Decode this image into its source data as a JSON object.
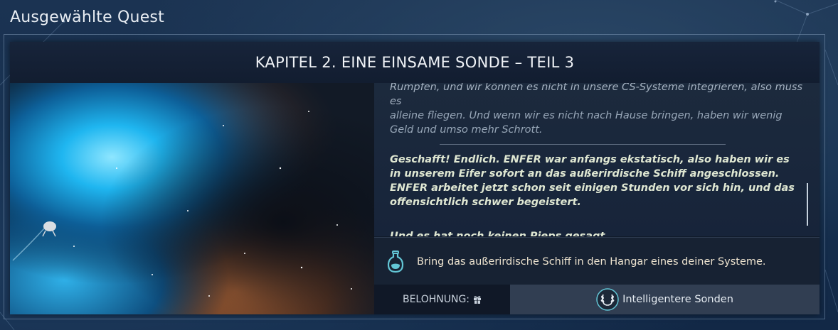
{
  "header": {
    "title": "Ausgewählte Quest"
  },
  "quest": {
    "chapter_title": "KAPITEL 2. EINE EINSAME SONDE – TEIL 3",
    "story": {
      "partial_line": "Rumpfen, und wir können es nicht in unsere CS-Systeme integrieren, also muss es",
      "paragraph_1": "alleine fliegen. Und wenn wir es nicht nach Hause bringen, haben wir wenig Geld und umso mehr Schrott.",
      "paragraph_2": "Geschafft! Endlich. ENFER war anfangs ekstatisch, also haben wir es in unserem Eifer sofort an das außerirdische Schiff angeschlossen. ENFER arbeitet jetzt schon seit einigen Stunden vor sich hin, und das offensichtlich schwer begeistert.",
      "paragraph_3": "Und es hat noch keinen Pieps gesagt ..."
    },
    "objective": {
      "icon": "flask-icon",
      "text": "Bring das außerirdische Schiff in den Hangar eines deiner Systeme."
    },
    "reward": {
      "label": "BELOHNUNG:",
      "label_icon": "gift-icon",
      "item_icon": "laurel-icon",
      "item_name": "Intelligentere Sonden"
    }
  },
  "colors": {
    "background": "#16304f",
    "panel": "#101a2a",
    "story_text": "#dfe7d2",
    "objective_text": "#ede3cf",
    "accent_teal": "#63c6d6"
  }
}
